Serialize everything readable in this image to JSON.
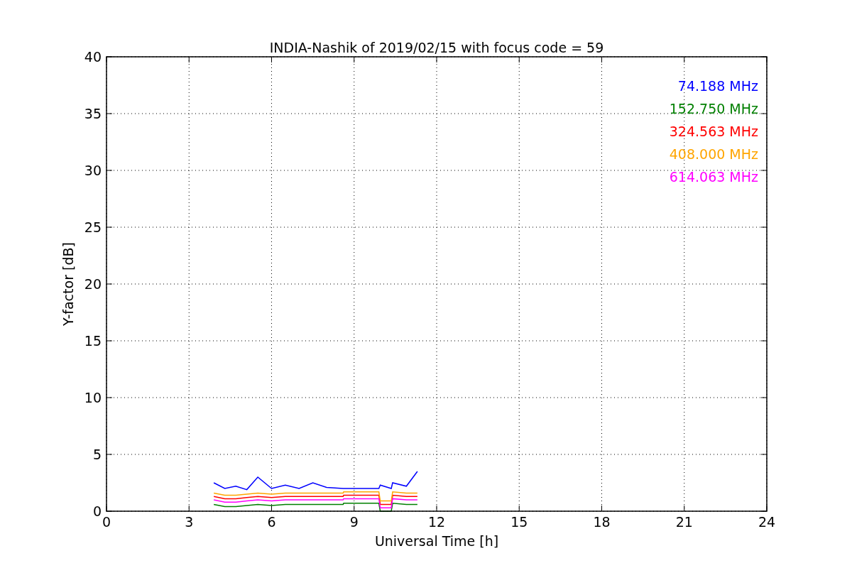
{
  "figure": {
    "chart_data": {
      "type": "line",
      "title": "INDIA-Nashik of 2019/02/15 with focus code = 59",
      "xlabel": "Universal Time [h]",
      "ylabel": "Y-factor [dB]",
      "x": [
        3.9,
        4.3,
        4.7,
        5.1,
        5.5,
        6.0,
        6.5,
        7.0,
        7.5,
        8.0,
        8.6,
        8.62,
        9.9,
        9.95,
        10.35,
        10.4,
        10.9,
        11.3
      ],
      "series": [
        {
          "name": "74.188 MHz",
          "color": "#0000ff",
          "values": [
            2.5,
            2.0,
            2.2,
            1.9,
            3.0,
            2.0,
            2.3,
            2.0,
            2.5,
            2.1,
            2.0,
            2.0,
            2.0,
            2.3,
            2.0,
            2.5,
            2.2,
            3.5
          ]
        },
        {
          "name": "152.750 MHz",
          "color": "#008000",
          "values": [
            0.6,
            0.4,
            0.4,
            0.5,
            0.6,
            0.5,
            0.6,
            0.6,
            0.6,
            0.6,
            0.6,
            0.7,
            0.7,
            0.0,
            0.0,
            0.7,
            0.6,
            0.6
          ]
        },
        {
          "name": "324.563 MHz",
          "color": "#ff0000",
          "values": [
            1.3,
            1.1,
            1.1,
            1.2,
            1.3,
            1.2,
            1.3,
            1.3,
            1.3,
            1.3,
            1.3,
            1.4,
            1.4,
            0.6,
            0.6,
            1.4,
            1.3,
            1.3
          ]
        },
        {
          "name": "408.000 MHz",
          "color": "#ffa500",
          "values": [
            1.6,
            1.4,
            1.4,
            1.5,
            1.6,
            1.5,
            1.6,
            1.6,
            1.6,
            1.6,
            1.6,
            1.7,
            1.7,
            0.9,
            0.9,
            1.7,
            1.6,
            1.6
          ]
        },
        {
          "name": "614.063 MHz",
          "color": "#ff00ff",
          "values": [
            1.0,
            0.8,
            0.8,
            0.9,
            1.0,
            0.9,
            1.0,
            1.0,
            1.0,
            1.0,
            1.0,
            1.1,
            1.1,
            0.3,
            0.3,
            1.1,
            1.0,
            1.0
          ]
        }
      ],
      "xlim": [
        0,
        24
      ],
      "ylim": [
        0,
        40
      ],
      "xticks": [
        0,
        3,
        6,
        9,
        12,
        15,
        18,
        21,
        24
      ],
      "yticks": [
        0,
        5,
        10,
        15,
        20,
        25,
        30,
        35,
        40
      ],
      "grid": true
    }
  }
}
